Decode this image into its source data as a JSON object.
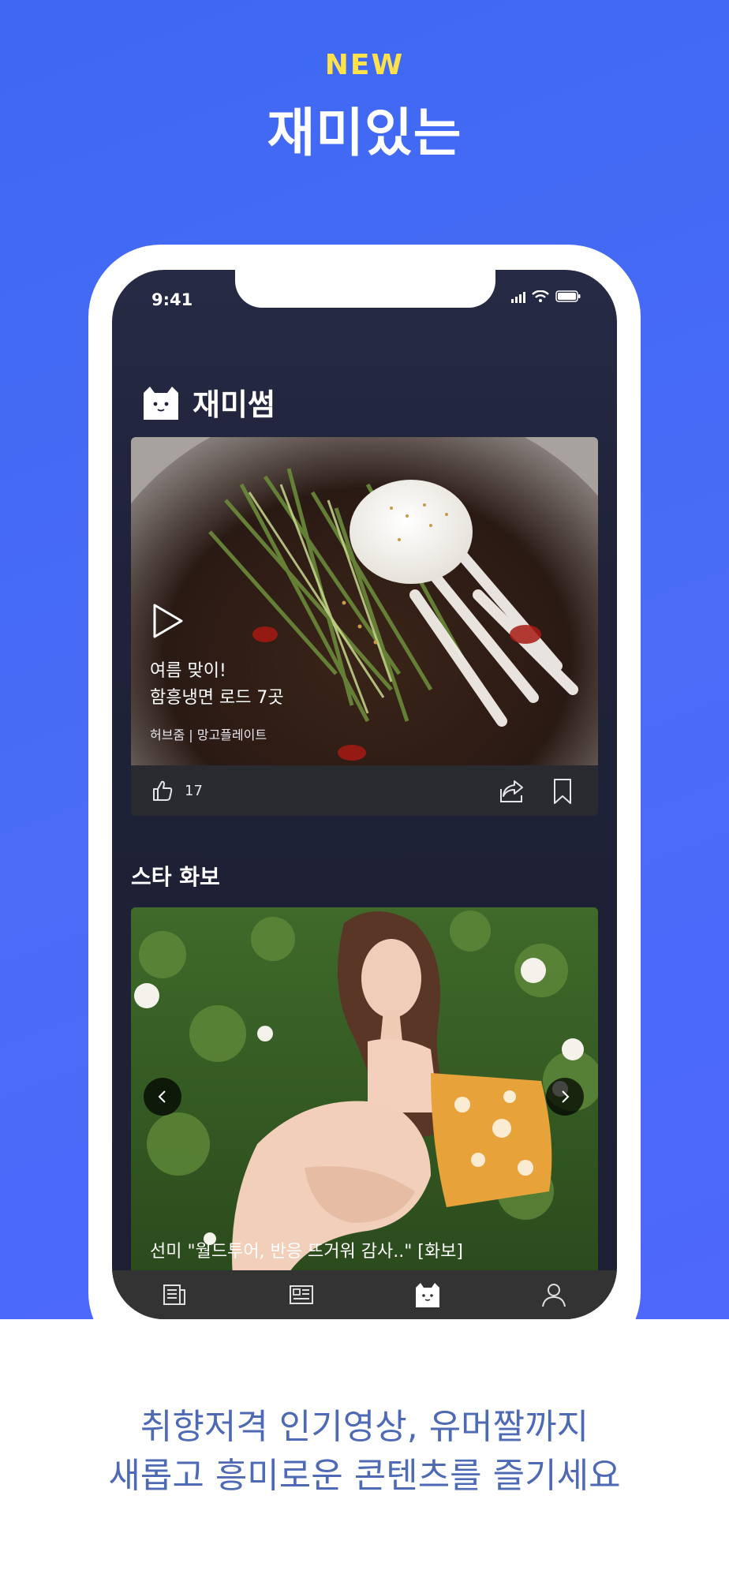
{
  "hero": {
    "badge": "NEW",
    "title": "재미있는"
  },
  "status_bar": {
    "time": "9:41"
  },
  "app": {
    "title": "재미썸"
  },
  "featured_card": {
    "line1": "여름 맞이!",
    "line2": "함흥냉면 로드 7곳",
    "source": "허브줌 | 망고플레이트",
    "likes": "17"
  },
  "section": {
    "title": "스타 화보"
  },
  "photo_card": {
    "caption": "선미 \"월드투어, 반응 뜨거워 감사..\" [화보]"
  },
  "tabs": [
    "news-tab",
    "article-tab",
    "cat-tab",
    "profile-tab"
  ],
  "promo": {
    "line1": "취향저격 인기영상, 유머짤까지",
    "line2": "새롭고 흥미로운 콘텐츠를 즐기세요"
  },
  "colors": {
    "hero_bg": "#4a6cf7",
    "badge": "#ffe14a",
    "screen_bg": "#1f2238",
    "promo_text": "#4f6ab5"
  }
}
